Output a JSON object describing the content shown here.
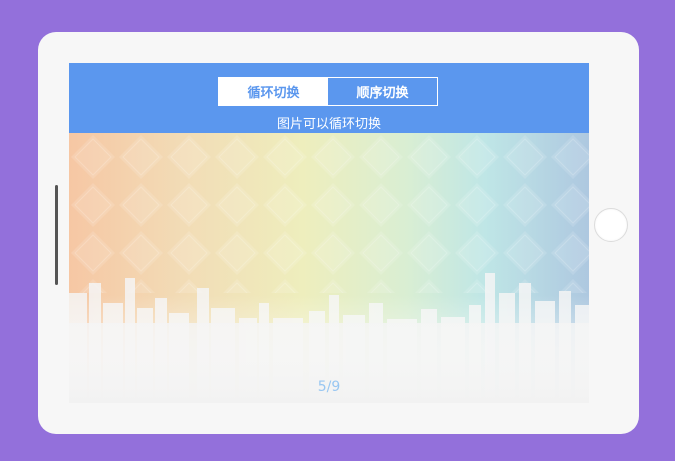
{
  "toggle": {
    "loop_label": "循环切换",
    "sequential_label": "顺序切换"
  },
  "subtitle": "图片可以循环切换",
  "pager": {
    "current": "5",
    "separator": "/",
    "total": "9"
  },
  "colors": {
    "page_background": "#9370db",
    "device_background": "#f7f7f7",
    "header_blue": "#5b97ee",
    "pager_text": "#99c7f2"
  },
  "slide": {
    "description_icon": "rainbow-city-skyline-image"
  }
}
